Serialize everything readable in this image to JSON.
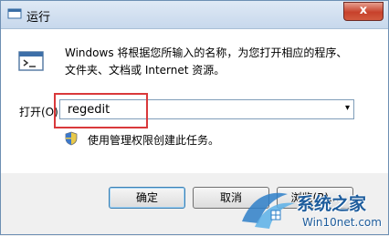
{
  "window": {
    "title": "运行",
    "close_glyph": "x"
  },
  "description": {
    "line1": "Windows 将根据您所输入的名称，为您打开相应的程序、",
    "line2": "文件夹、文档或 Internet 资源。"
  },
  "open_field": {
    "label": "打开(O):",
    "value": "regedit",
    "dropdown_glyph": "▾"
  },
  "admin_note": "使用管理权限创建此任务。",
  "buttons": {
    "ok": "确定",
    "cancel": "取消",
    "browse": "浏览(B)..."
  },
  "watermark": {
    "title": "系统之家",
    "url": "Win10net.com"
  },
  "colors": {
    "highlight": "#d9393b",
    "watermark": "#1d5c9c"
  }
}
